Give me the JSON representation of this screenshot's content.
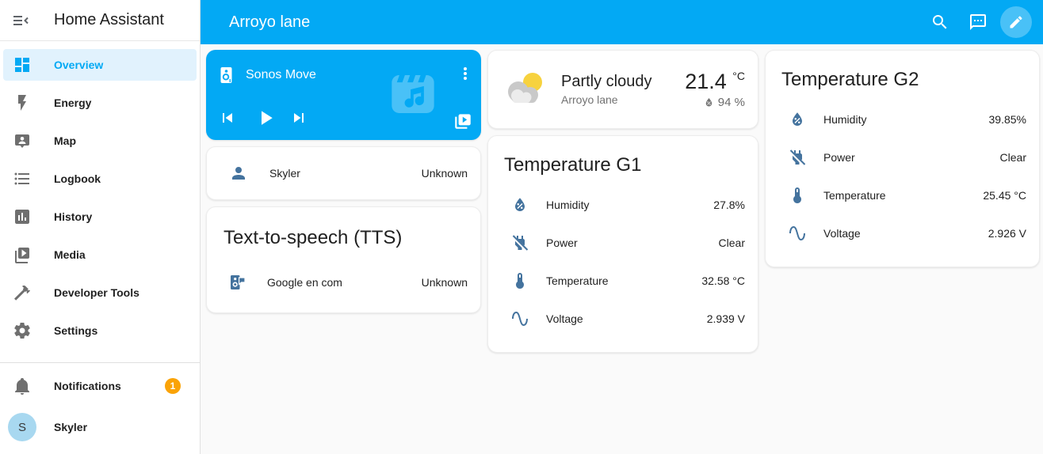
{
  "app": {
    "title": "Home Assistant"
  },
  "header": {
    "title": "Arroyo lane"
  },
  "colors": {
    "accent": "#03a9f4",
    "entity_icon": "#44739e",
    "badge": "#faa307",
    "active_item_bg": "#e1f2fd"
  },
  "sidebar": {
    "items": [
      {
        "label": "Overview",
        "icon": "view-dashboard-icon",
        "active": true
      },
      {
        "label": "Energy",
        "icon": "lightning-bolt-icon",
        "active": false
      },
      {
        "label": "Map",
        "icon": "account-location-icon",
        "active": false
      },
      {
        "label": "Logbook",
        "icon": "list-bulleted-icon",
        "active": false
      },
      {
        "label": "History",
        "icon": "chart-box-icon",
        "active": false
      },
      {
        "label": "Media",
        "icon": "play-box-multiple-icon",
        "active": false
      },
      {
        "label": "Developer Tools",
        "icon": "hammer-icon",
        "active": false
      },
      {
        "label": "Settings",
        "icon": "gear-icon",
        "active": false
      }
    ],
    "notifications": {
      "label": "Notifications",
      "badge": "1"
    },
    "user": {
      "name": "Skyler",
      "initial": "S"
    }
  },
  "cards": {
    "media_player": {
      "name": "Sonos Move"
    },
    "person": {
      "name": "Skyler",
      "state": "Unknown"
    },
    "tts": {
      "title": "Text-to-speech (TTS)",
      "engine": "Google en com",
      "state": "Unknown"
    },
    "weather": {
      "condition": "Partly cloudy",
      "location": "Arroyo lane",
      "temperature": "21.4",
      "temperature_unit": "°C",
      "humidity": "94 %"
    },
    "temp_g1": {
      "title": "Temperature G1",
      "rows": [
        {
          "label": "Humidity",
          "value": "27.8%"
        },
        {
          "label": "Power",
          "value": "Clear"
        },
        {
          "label": "Temperature",
          "value": "32.58 °C"
        },
        {
          "label": "Voltage",
          "value": "2.939 V"
        }
      ]
    },
    "temp_g2": {
      "title": "Temperature G2",
      "rows": [
        {
          "label": "Humidity",
          "value": "39.85%"
        },
        {
          "label": "Power",
          "value": "Clear"
        },
        {
          "label": "Temperature",
          "value": "25.45 °C"
        },
        {
          "label": "Voltage",
          "value": "2.926 V"
        }
      ]
    }
  }
}
